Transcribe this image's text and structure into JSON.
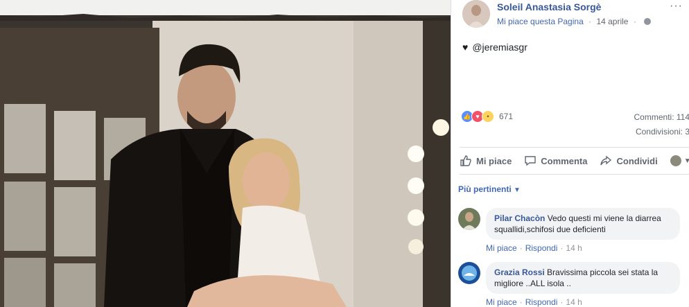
{
  "post": {
    "author": "Soleil Anastasia Sorgè",
    "page_like": "Mi piace questa Pagina",
    "date": "14 aprile",
    "more": "···",
    "caption": "@jeremiasgr",
    "reaction_count": "671",
    "comments_stat": "Commenti: 114",
    "shares_stat": "Condivisioni: 3"
  },
  "actions": {
    "like": "Mi piace",
    "comment": "Commenta",
    "share": "Condividi"
  },
  "filter": {
    "label": "Più pertinenti"
  },
  "comments": [
    {
      "name": "Pilar Chacòn",
      "text": "Vedo questi mi viene la diarrea squallidi,schifosi due deficienti",
      "like": "Mi piace",
      "reply": "Rispondi",
      "time": "14 h"
    },
    {
      "name": "Grazia Rossi",
      "text": "Bravissima piccola sei stata la migliore ..ALL isola ..",
      "like": "Mi piace",
      "reply": "Rispondi",
      "time": "14 h"
    }
  ],
  "colors": {
    "link": "#365899",
    "accent": "#4267b2",
    "bubble": "#f2f3f5",
    "like_reaction": "#5890ff",
    "love_reaction": "#f25268",
    "wow_reaction": "#fcd35e"
  }
}
